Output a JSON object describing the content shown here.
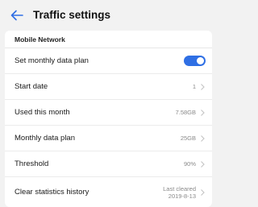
{
  "header": {
    "title": "Traffic settings"
  },
  "section": {
    "label": "Mobile Network"
  },
  "rows": {
    "monthly_plan_toggle": {
      "label": "Set monthly data plan",
      "on": true
    },
    "start_date": {
      "label": "Start date",
      "value": "1"
    },
    "used_this_month": {
      "label": "Used this month",
      "value": "7.58GB"
    },
    "monthly_data_plan": {
      "label": "Monthly data plan",
      "value": "25GB"
    },
    "threshold": {
      "label": "Threshold",
      "value": "90%"
    },
    "clear_history": {
      "label": "Clear statistics history",
      "value_line1": "Last cleared",
      "value_line2": "2019-8-13"
    }
  },
  "colors": {
    "accent": "#2f6fe4",
    "background": "#f2f2f2",
    "card": "#ffffff",
    "secondary_text": "#8a8a8a"
  },
  "icons": {
    "back": "arrow-left-icon",
    "chevron": "chevron-right-icon"
  }
}
